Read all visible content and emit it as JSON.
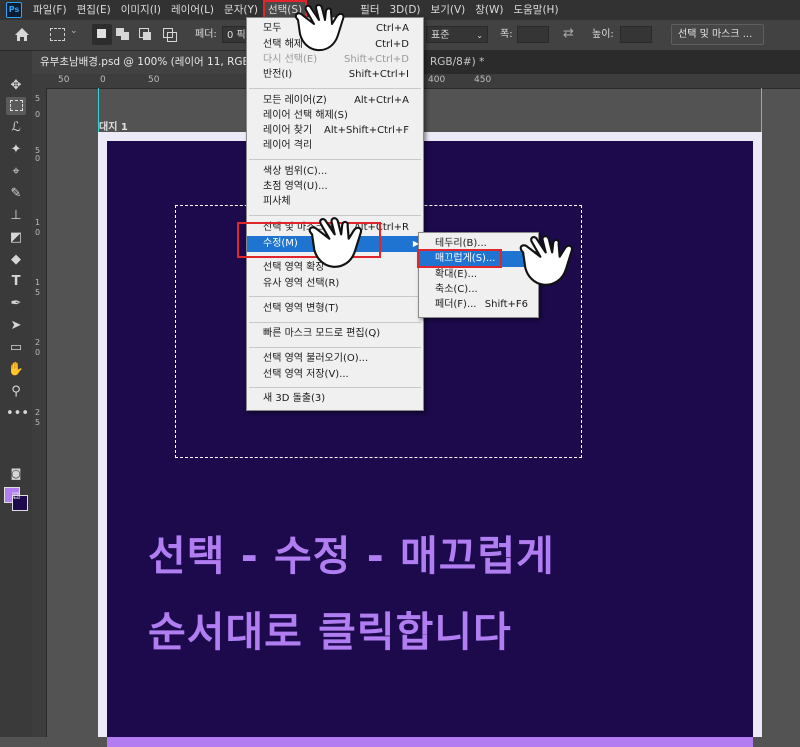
{
  "menubar": {
    "logo": "Ps",
    "items": [
      "파일(F)",
      "편집(E)",
      "이미지(I)",
      "레이어(L)",
      "문자(Y)",
      "선택(S)",
      "필터",
      "3D(D)",
      "보기(V)",
      "창(W)",
      "도움말(H)"
    ]
  },
  "options_bar": {
    "feather_label": "페더:",
    "feather_value": "0 픽셀",
    "style_value": "표준",
    "width_label": "폭:",
    "height_label": "높이:",
    "select_mask_button": "선택 및 마스크 ..."
  },
  "tabs": {
    "active": "유부초남배경.psd @ 100% (레이어 11, RGB/8#)",
    "second": "RGB/8#) *"
  },
  "rulers": {
    "h": [
      "50",
      "0",
      "50",
      "400",
      "450"
    ],
    "v": [
      "5",
      "0",
      "5",
      "0",
      "1",
      "0",
      "1",
      "5",
      "2",
      "0",
      "2",
      "5"
    ]
  },
  "canvas": {
    "artboard_label": "대지 1",
    "line1": "선택 - 수정 - 매끄럽게",
    "line2": "순서대로 클릭합니다"
  },
  "select_menu": {
    "items": [
      {
        "label": "모두",
        "shortcut": "Ctrl+A"
      },
      {
        "label": "선택 해제",
        "shortcut": "Ctrl+D"
      },
      {
        "label": "다시 선택(E)",
        "shortcut": "Shift+Ctrl+D"
      },
      {
        "label": "반전(I)",
        "shortcut": "Shift+Ctrl+I"
      },
      {
        "label": "모든 레이어(Z)",
        "shortcut": "Alt+Ctrl+A"
      },
      {
        "label": "레이어 선택 해제(S)",
        "shortcut": ""
      },
      {
        "label": "레이어 찾기",
        "shortcut": "Alt+Shift+Ctrl+F"
      },
      {
        "label": "레이어 격리",
        "shortcut": ""
      },
      {
        "label": "색상 범위(C)...",
        "shortcut": ""
      },
      {
        "label": "초점 영역(U)...",
        "shortcut": ""
      },
      {
        "label": "피사체",
        "shortcut": ""
      },
      {
        "label": "선택 및 마스크(K)...",
        "shortcut": "Alt+Ctrl+R"
      },
      {
        "label": "수정(M)",
        "shortcut": ""
      },
      {
        "label": "선택 영역 확장",
        "shortcut": ""
      },
      {
        "label": "유사 영역 선택(R)",
        "shortcut": ""
      },
      {
        "label": "선택 영역 변형(T)",
        "shortcut": ""
      },
      {
        "label": "빠른 마스크 모드로 편집(Q)",
        "shortcut": ""
      },
      {
        "label": "선택 영역 불러오기(O)...",
        "shortcut": ""
      },
      {
        "label": "선택 영역 저장(V)...",
        "shortcut": ""
      },
      {
        "label": "새 3D 돌출(3)",
        "shortcut": ""
      }
    ]
  },
  "modify_submenu": {
    "items": [
      {
        "label": "테두리(B)...",
        "shortcut": ""
      },
      {
        "label": "매끄럽게(S)...",
        "shortcut": ""
      },
      {
        "label": "확대(E)...",
        "shortcut": ""
      },
      {
        "label": "축소(C)...",
        "shortcut": ""
      },
      {
        "label": "페더(F)...",
        "shortcut": "Shift+F6"
      }
    ]
  },
  "colors": {
    "accent_purple": "#b07ef0",
    "canvas_bg": "#1c0a4d",
    "highlight_blue": "#1f74d1",
    "annotation_red": "#e0262a"
  }
}
